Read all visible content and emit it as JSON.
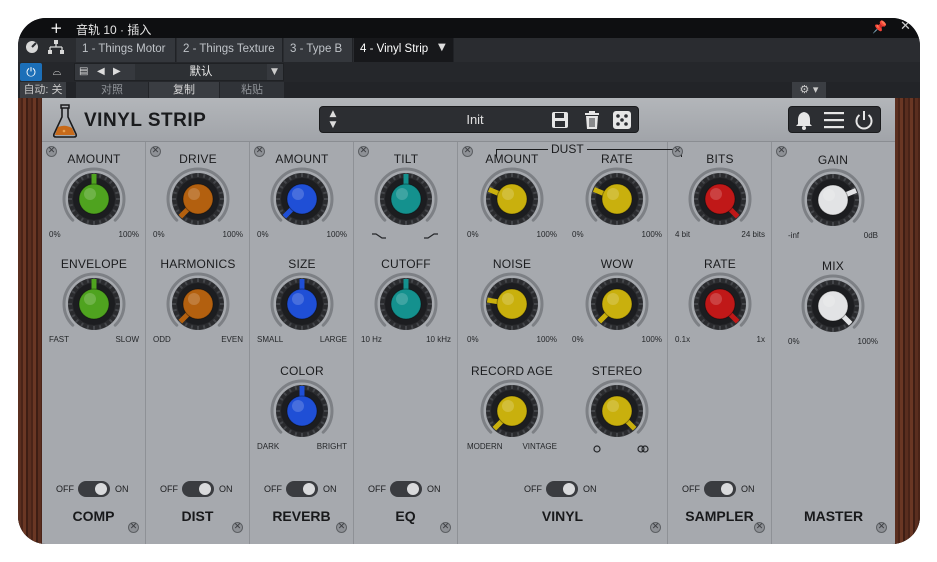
{
  "window": {
    "title": "音轨 10 · 插入"
  },
  "tabs": [
    {
      "label": "1 - Things Motor",
      "active": false
    },
    {
      "label": "2 - Things Texture",
      "active": false
    },
    {
      "label": "3 - Type B",
      "active": false
    },
    {
      "label": "4 - Vinyl Strip",
      "active": true
    }
  ],
  "host": {
    "preset_name": "默认",
    "auto_label": "自动: 关",
    "compare_label": "对照",
    "copy_label": "复制",
    "paste_label": "粘贴"
  },
  "plugin": {
    "name": "VINYL STRIP",
    "preset": "Init"
  },
  "toggle_labels": {
    "off": "OFF",
    "on": "ON"
  },
  "dust_label": "DUST",
  "modules": [
    {
      "name": "COMP",
      "knobs": [
        {
          "label": "AMOUNT",
          "min": "0%",
          "max": "100%",
          "value": 0.5,
          "color": "#4fa31f"
        },
        {
          "label": "ENVELOPE",
          "min": "FAST",
          "max": "SLOW",
          "value": 0.5,
          "color": "#4fa31f"
        }
      ]
    },
    {
      "name": "DIST",
      "knobs": [
        {
          "label": "DRIVE",
          "min": "0%",
          "max": "100%",
          "value": 0.0,
          "color": "#b3600f"
        },
        {
          "label": "HARMONICS",
          "min": "ODD",
          "max": "EVEN",
          "value": 0.0,
          "color": "#b3600f"
        }
      ]
    },
    {
      "name": "REVERB",
      "knobs": [
        {
          "label": "AMOUNT",
          "min": "0%",
          "max": "100%",
          "value": 0.0,
          "color": "#1f4fd6"
        },
        {
          "label": "SIZE",
          "min": "SMALL",
          "max": "LARGE",
          "value": 0.5,
          "color": "#1f4fd6"
        },
        {
          "label": "COLOR",
          "min": "DARK",
          "max": "BRIGHT",
          "value": 0.5,
          "color": "#1f4fd6"
        }
      ]
    },
    {
      "name": "EQ",
      "knobs": [
        {
          "label": "TILT",
          "min": "",
          "max": "",
          "value": 0.5,
          "color": "#14918e"
        },
        {
          "label": "CUTOFF",
          "min": "10 Hz",
          "max": "10 kHz",
          "value": 0.5,
          "color": "#14918e"
        }
      ]
    },
    {
      "name": "VINYL",
      "knobs": [
        {
          "label": "AMOUNT",
          "min": "0%",
          "max": "100%",
          "value": 0.25,
          "color": "#c9b00d"
        },
        {
          "label": "RATE",
          "min": "0%",
          "max": "100%",
          "value": 0.25,
          "color": "#c9b00d"
        },
        {
          "label": "NOISE",
          "min": "0%",
          "max": "100%",
          "value": 0.2,
          "color": "#c9b00d"
        },
        {
          "label": "WOW",
          "min": "0%",
          "max": "100%",
          "value": 0.0,
          "color": "#c9b00d"
        },
        {
          "label": "RECORD AGE",
          "min": "MODERN",
          "max": "VINTAGE",
          "value": 0.0,
          "color": "#c9b00d"
        },
        {
          "label": "STEREO",
          "min": "",
          "max": "",
          "value": 1.0,
          "color": "#c9b00d"
        }
      ]
    },
    {
      "name": "SAMPLER",
      "knobs": [
        {
          "label": "BITS",
          "min": "4 bit",
          "max": "24 bits",
          "value": 1.0,
          "color": "#c01818"
        },
        {
          "label": "RATE",
          "min": "0.1x",
          "max": "1x",
          "value": 1.0,
          "color": "#c01818"
        }
      ]
    },
    {
      "name": "MASTER",
      "knobs": [
        {
          "label": "GAIN",
          "min": "-inf",
          "max": "0dB",
          "value": 0.75,
          "color": "#e2e3e5"
        },
        {
          "label": "MIX",
          "min": "0%",
          "max": "100%",
          "value": 1.0,
          "color": "#e2e3e5"
        }
      ]
    }
  ]
}
